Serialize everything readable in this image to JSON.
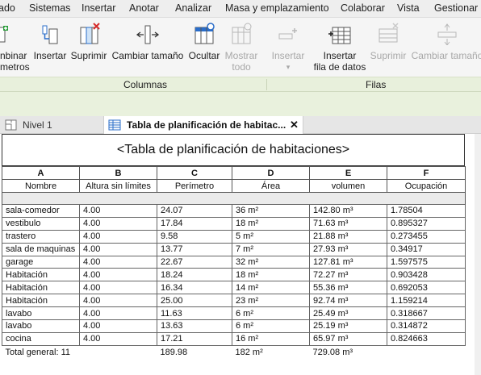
{
  "menu": [
    "ado",
    "Sistemas",
    "Insertar",
    "Anotar",
    "Analizar",
    "Masa y emplazamiento",
    "Colaborar",
    "Vista",
    "Gestionar"
  ],
  "ribbon": {
    "buttons": [
      {
        "line1": "nbinar",
        "line2": "metros",
        "icon": "combine-parameters-icon",
        "enabled": true
      },
      {
        "line1": "Insertar",
        "line2": "",
        "icon": "insert-column-icon",
        "enabled": true
      },
      {
        "line1": "Suprimir",
        "line2": "",
        "icon": "delete-column-icon",
        "enabled": true
      },
      {
        "line1": "Cambiar tamaño",
        "line2": "",
        "icon": "resize-column-icon",
        "enabled": true
      },
      {
        "line1": "Ocultar",
        "line2": "",
        "icon": "hide-column-icon",
        "enabled": true
      },
      {
        "line1": "Mostrar",
        "line2": "todo",
        "icon": "show-all-icon",
        "enabled": false
      },
      {
        "line1": "Insertar",
        "line2": "▾",
        "icon": "insert-row-icon",
        "enabled": false
      },
      {
        "line1": "Insertar",
        "line2": "fila de datos",
        "icon": "insert-data-row-icon",
        "enabled": true
      },
      {
        "line1": "Suprimir",
        "line2": "",
        "icon": "delete-row-icon",
        "enabled": false
      },
      {
        "line1": "Cambiar tamaño",
        "line2": "",
        "icon": "resize-row-icon",
        "enabled": false
      }
    ],
    "groups": [
      "Columnas",
      "Filas"
    ]
  },
  "tabs": [
    {
      "label": "Nivel 1",
      "icon": "floor-plan-icon",
      "active": false
    },
    {
      "label": "Tabla de planificación de habitac...",
      "icon": "schedule-icon",
      "active": true,
      "close": "✕"
    }
  ],
  "schedule": {
    "title": "<Tabla de planificación de habitaciones>",
    "letters": [
      "A",
      "B",
      "C",
      "D",
      "E",
      "F"
    ],
    "headers": [
      "Nombre",
      "Altura sin límites",
      "Perímetro",
      "Área",
      "volumen",
      "Ocupación"
    ],
    "rows": [
      [
        "sala-comedor",
        "4.00",
        "24.07",
        "36 m²",
        "142.80 m³",
        "1.78504"
      ],
      [
        "vestibulo",
        "4.00",
        "17.84",
        "18 m²",
        "71.63 m³",
        "0.895327"
      ],
      [
        "trastero",
        "4.00",
        "9.58",
        "5 m²",
        "21.88 m³",
        "0.273455"
      ],
      [
        "sala de maquinas",
        "4.00",
        "13.77",
        "7 m²",
        "27.93 m³",
        "0.34917"
      ],
      [
        "garage",
        "4.00",
        "22.67",
        "32 m²",
        "127.81 m³",
        "1.597575"
      ],
      [
        "Habitación",
        "4.00",
        "18.24",
        "18 m²",
        "72.27 m³",
        "0.903428"
      ],
      [
        "Habitación",
        "4.00",
        "16.34",
        "14 m²",
        "55.36 m³",
        "0.692053"
      ],
      [
        "Habitación",
        "4.00",
        "25.00",
        "23 m²",
        "92.74 m³",
        "1.159214"
      ],
      [
        "lavabo",
        "4.00",
        "11.63",
        "6 m²",
        "25.49 m³",
        "0.318667"
      ],
      [
        "lavabo",
        "4.00",
        "13.63",
        "6 m²",
        "25.19 m³",
        "0.314872"
      ],
      [
        "cocina",
        "4.00",
        "17.21",
        "16 m²",
        "65.97 m³",
        "0.824663"
      ]
    ],
    "total": [
      "Total general: 11",
      "",
      "189.98",
      "182 m²",
      "729.08 m³",
      ""
    ]
  }
}
